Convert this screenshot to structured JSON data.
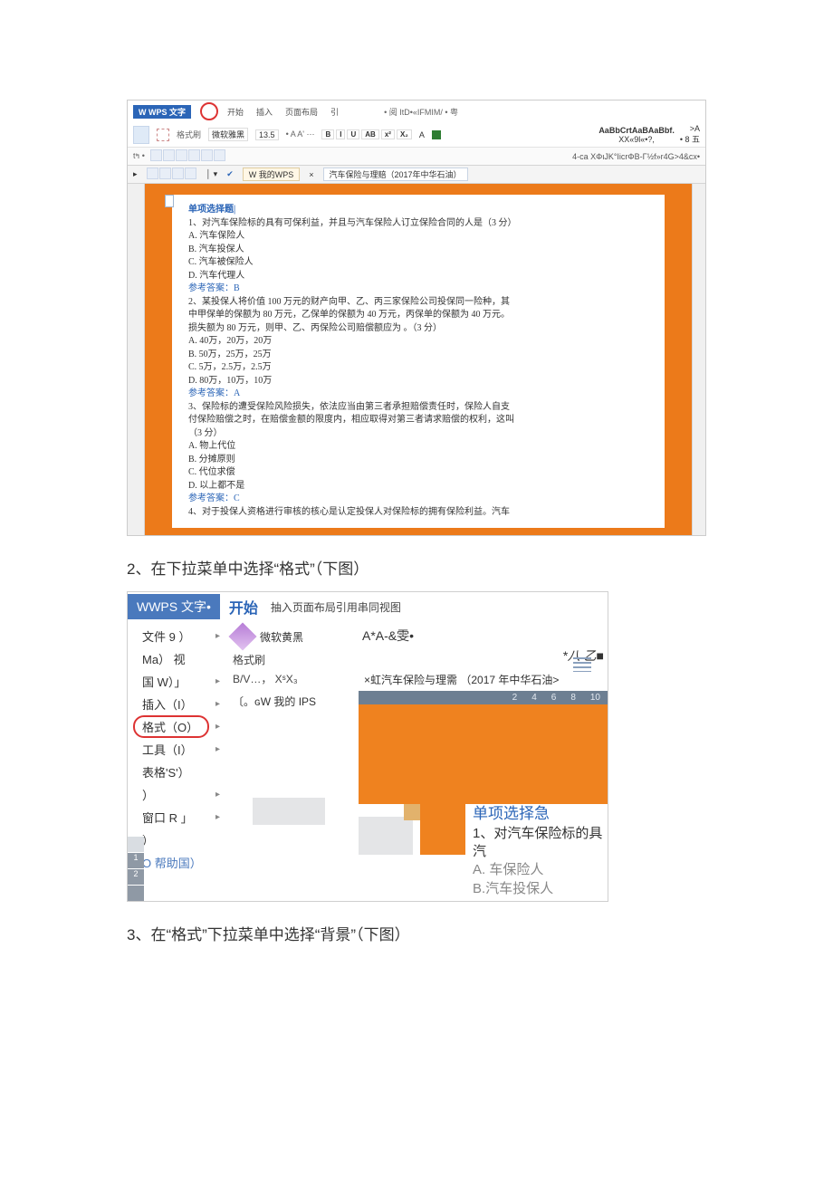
{
  "wps1": {
    "logo": "W WPS 文字",
    "tabs": [
      "开始",
      "插入",
      "页面布局",
      "引"
    ],
    "title_extra": "• 阅 ItD•«IFMIM/ • 粤",
    "row2": {
      "fmt_label": "格式刷",
      "font_name": "微软雅黑",
      "font_size": "13.5",
      "font_hint": "• A A' ⋯",
      "btn_b": "B",
      "btn_i": "I",
      "btn_u": "U",
      "btn_ab": "AB",
      "btn_x2": "x²",
      "btn_x2b": "X₂",
      "color_lbl": "A",
      "styles_line1": "AaBbCrtAaBAaBbf.",
      "styles_line2": "XX«9l«•?,",
      "arrow": ">A",
      "size_lbl": "• 8 五"
    },
    "row3_right": "4-ca    XΦιJK°IicrΦB-Γ½f»r4G>4&cx•",
    "row4": {
      "chip1": "W 我的WPS",
      "chip2": "汽车保险与理赔（2017年中华石油）",
      "prefix": "×"
    },
    "doc": {
      "heading": "单项选择题",
      "q1": "1、对汽车保险标的具有可保利益，并且与汽车保险人订立保险合同的人是（3 分）",
      "q1a": "A. 汽车保险人",
      "q1b": "B. 汽车投保人",
      "q1c": "C. 汽车被保险人",
      "q1d": "D. 汽车代理人",
      "ans1": "参考答案：B",
      "q2a": "2、某投保人将价值 100 万元的财产向甲、乙、丙三家保险公司投保同一险种，其",
      "q2b": "中甲保单的保额为 80 万元，乙保单的保额为 40 万元，丙保单的保额为 40 万元。",
      "q2c": "损失额为 80 万元，则甲、乙、丙保险公司赔偿额应为 。（3 分）",
      "q2o1": "A. 40万，20万，20万",
      "q2o2": "B. 50万，25万，25万",
      "q2o3": "C. 5万，2.5万，2.5万",
      "q2o4": "D. 80万，10万，10万",
      "ans2": "参考答案：A",
      "q3a": "3、保险标的遭受保险风险损失，依法应当由第三者承担赔偿责任时，保险人自支",
      "q3b": "付保险赔偿之时，在赔偿金额的限度内，相应取得对第三者请求赔偿的权利，这叫",
      "q3c": "（3 分）",
      "q3o1": "A. 物上代位",
      "q3o2": "B. 分摊原则",
      "q3o3": "C. 代位求偿",
      "q3o4": "D. 以上都不是",
      "ans3": "参考答案：C",
      "q4": "4、对于投保人资格进行审核的核心是认定投保人对保险标的拥有保险利益。汽车"
    }
  },
  "caption2": "2、在下拉菜单中选择“格式”（下图）",
  "wps2": {
    "logo": "WWPS 文字•",
    "start": "开始",
    "tabs_rest": "抽入页面布局引用串同视图",
    "menu": {
      "file": "文件 9 ）",
      "view1": "Ma） 视",
      "view2": "国 W）」",
      "insert": "插入（I）",
      "format": "格式（O）",
      "tools": "工具（I）",
      "table": "表格'S'）",
      "paren": "）",
      "window": "窗口 R 」",
      "help": "O 帮助国）"
    },
    "center": {
      "fmt_brush": "格式刷",
      "font_name": "微软黄黑",
      "font_line": "B/V…， XˢX₃",
      "ips": "〔。ɢW 我的 IPS"
    },
    "right": {
      "style1": "A*A-&雯•",
      "style2": "*八 乙■",
      "tab_title": "×虹汽车保险与理需 （2017 年中华石油>",
      "ruler": [
        "2",
        "4",
        "6",
        "8",
        "10"
      ],
      "peek_title": "单项选择急",
      "peek_q": "1、对汽车保险标的具汽",
      "peek_a": "A. 车保险人",
      "peek_b": "B.汽车投保人"
    }
  },
  "caption3": "3、在“格式”下拉菜单中选择“背景”（下图）"
}
